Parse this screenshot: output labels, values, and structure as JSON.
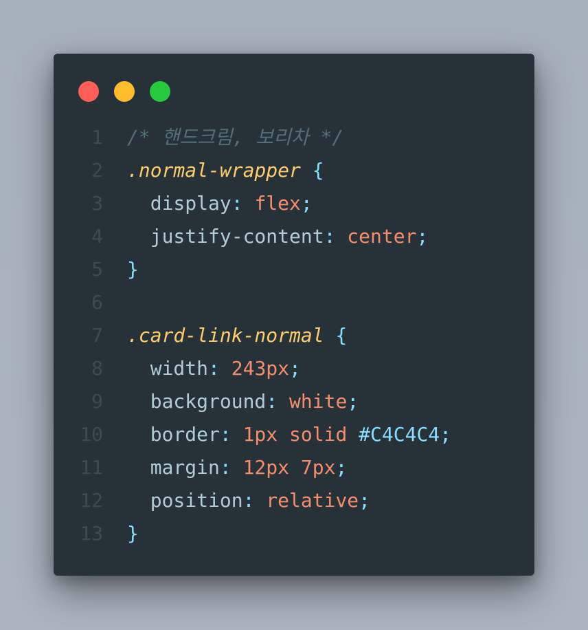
{
  "window": {
    "buttons": [
      {
        "name": "close",
        "color": "#ff5f56"
      },
      {
        "name": "minimize",
        "color": "#ffbd2e"
      },
      {
        "name": "maximize",
        "color": "#27c93f"
      }
    ]
  },
  "code": {
    "lines": [
      {
        "n": "1",
        "tokens": [
          {
            "t": "/* 핸드크림, 보리차 */",
            "k": "comment"
          }
        ]
      },
      {
        "n": "2",
        "tokens": [
          {
            "t": ".normal-wrapper",
            "k": "selector"
          },
          {
            "t": " ",
            "k": "plain"
          },
          {
            "t": "{",
            "k": "brace"
          }
        ]
      },
      {
        "n": "3",
        "tokens": [
          {
            "t": "  display",
            "k": "prop"
          },
          {
            "t": ": ",
            "k": "punct"
          },
          {
            "t": "flex",
            "k": "value"
          },
          {
            "t": ";",
            "k": "punct"
          }
        ]
      },
      {
        "n": "4",
        "tokens": [
          {
            "t": "  justify-content",
            "k": "prop"
          },
          {
            "t": ": ",
            "k": "punct"
          },
          {
            "t": "center",
            "k": "value"
          },
          {
            "t": ";",
            "k": "punct"
          }
        ]
      },
      {
        "n": "5",
        "tokens": [
          {
            "t": "}",
            "k": "brace"
          }
        ]
      },
      {
        "n": "6",
        "tokens": []
      },
      {
        "n": "7",
        "tokens": [
          {
            "t": ".card-link-normal",
            "k": "selector"
          },
          {
            "t": " ",
            "k": "plain"
          },
          {
            "t": "{",
            "k": "brace"
          }
        ]
      },
      {
        "n": "8",
        "tokens": [
          {
            "t": "  width",
            "k": "prop"
          },
          {
            "t": ": ",
            "k": "punct"
          },
          {
            "t": "243px",
            "k": "value"
          },
          {
            "t": ";",
            "k": "punct"
          }
        ]
      },
      {
        "n": "9",
        "tokens": [
          {
            "t": "  background",
            "k": "prop"
          },
          {
            "t": ": ",
            "k": "punct"
          },
          {
            "t": "white",
            "k": "value"
          },
          {
            "t": ";",
            "k": "punct"
          }
        ]
      },
      {
        "n": "10",
        "tokens": [
          {
            "t": "  border",
            "k": "prop"
          },
          {
            "t": ": ",
            "k": "punct"
          },
          {
            "t": "1px solid ",
            "k": "value"
          },
          {
            "t": "#C4C4C4",
            "k": "hex"
          },
          {
            "t": ";",
            "k": "punct"
          }
        ]
      },
      {
        "n": "11",
        "tokens": [
          {
            "t": "  margin",
            "k": "prop"
          },
          {
            "t": ": ",
            "k": "punct"
          },
          {
            "t": "12px 7px",
            "k": "value"
          },
          {
            "t": ";",
            "k": "punct"
          }
        ]
      },
      {
        "n": "12",
        "tokens": [
          {
            "t": "  position",
            "k": "prop"
          },
          {
            "t": ": ",
            "k": "punct"
          },
          {
            "t": "relative",
            "k": "value"
          },
          {
            "t": ";",
            "k": "punct"
          }
        ]
      },
      {
        "n": "13",
        "tokens": [
          {
            "t": "}",
            "k": "brace"
          }
        ]
      }
    ]
  },
  "colors": {
    "background": "#a9b3be",
    "window": "#263238",
    "comment": "#546e7a",
    "selector": "#ffcb6b",
    "brace": "#89ddff",
    "property": "#b2ccd6",
    "value": "#f78c6c",
    "line_number": "#3b4b53"
  }
}
